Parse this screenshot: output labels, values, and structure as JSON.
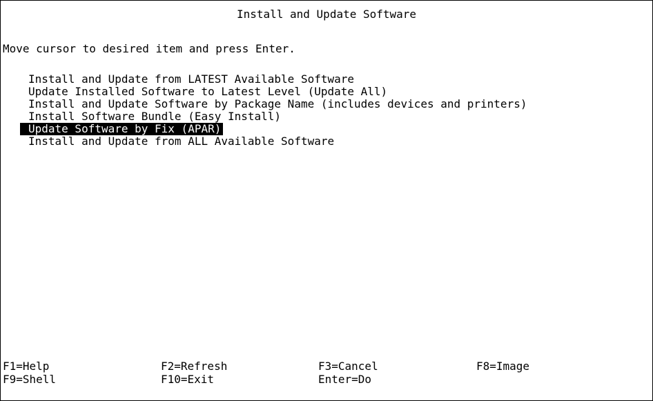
{
  "screen": {
    "title": "Install and Update Software",
    "instruction": "Move cursor to desired item and press Enter."
  },
  "menu": {
    "selected_index": 4,
    "items": [
      {
        "label": "Install and Update from LATEST Available Software"
      },
      {
        "label": "Update Installed Software to Latest Level (Update All)"
      },
      {
        "label": "Install and Update Software by Package Name (includes devices and printers)"
      },
      {
        "label": "Install Software Bundle (Easy Install)"
      },
      {
        "label": "Update Software by Fix (APAR)"
      },
      {
        "label": "Install and Update from ALL Available Software"
      }
    ]
  },
  "function_keys": {
    "row1": [
      {
        "label": "F1=Help"
      },
      {
        "label": "F2=Refresh"
      },
      {
        "label": "F3=Cancel"
      },
      {
        "label": "F8=Image"
      }
    ],
    "row2": [
      {
        "label": "F9=Shell"
      },
      {
        "label": "F10=Exit"
      },
      {
        "label": "Enter=Do"
      }
    ]
  },
  "colors": {
    "background": "#ffffff",
    "foreground": "#000000",
    "highlight_background": "#000000",
    "highlight_foreground": "#ffffff"
  }
}
